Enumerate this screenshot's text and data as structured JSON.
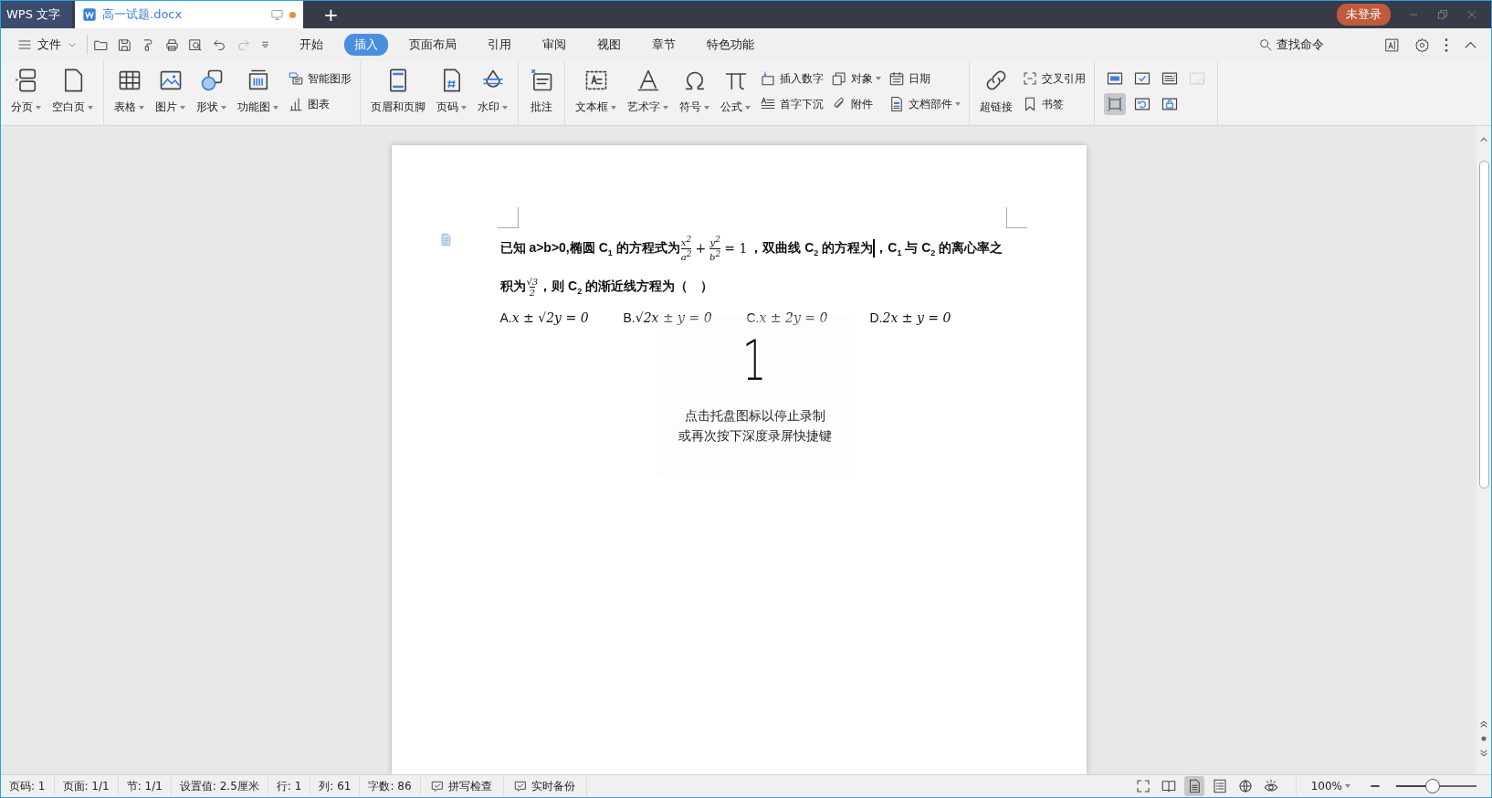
{
  "title_bar": {
    "app_tab": "WPS 文字",
    "document_tab": {
      "title": "高一试题.docx",
      "modified": true
    },
    "new_tab": "+",
    "login_button": "未登录"
  },
  "menu_bar": {
    "file_menu": "文件",
    "quick_access": [
      {
        "disabled": false
      },
      {
        "disabled": false
      },
      {
        "disabled": false
      },
      {
        "disabled": false
      },
      {
        "disabled": false
      },
      {
        "disabled": false
      },
      {
        "disabled": true
      }
    ],
    "tabs": [
      {
        "label": "开始",
        "selected": false
      },
      {
        "label": "插入",
        "selected": true
      },
      {
        "label": "页面布局",
        "selected": false
      },
      {
        "label": "引用",
        "selected": false
      },
      {
        "label": "审阅",
        "selected": false
      },
      {
        "label": "视图",
        "selected": false
      },
      {
        "label": "章节",
        "selected": false
      },
      {
        "label": "特色功能",
        "selected": false
      }
    ],
    "search_command": "查找命令"
  },
  "ribbon": {
    "groups": [
      {
        "items": [
          {
            "kind": "large",
            "label": "分页",
            "dropdown": true
          },
          {
            "kind": "large",
            "label": "空白页",
            "dropdown": true
          }
        ]
      },
      {
        "items": [
          {
            "kind": "large",
            "label": "表格",
            "dropdown": true
          },
          {
            "kind": "large",
            "label": "图片",
            "dropdown": true
          },
          {
            "kind": "large",
            "label": "形状",
            "dropdown": true
          },
          {
            "kind": "large",
            "label": "功能图",
            "dropdown": true
          },
          {
            "kind": "stack",
            "items": [
              {
                "label": "智能图形",
                "dropdown": false
              },
              {
                "label": "图表",
                "dropdown": false
              }
            ]
          }
        ]
      },
      {
        "items": [
          {
            "kind": "large",
            "label": "页眉和页脚",
            "dropdown": false
          },
          {
            "kind": "large",
            "label": "页码",
            "dropdown": true
          },
          {
            "kind": "large",
            "label": "水印",
            "dropdown": true
          }
        ]
      },
      {
        "items": [
          {
            "kind": "large",
            "label": "批注",
            "dropdown": false
          }
        ]
      },
      {
        "items": [
          {
            "kind": "large",
            "label": "文本框",
            "dropdown": true
          },
          {
            "kind": "large",
            "label": "艺术字",
            "dropdown": true
          },
          {
            "kind": "large",
            "label": "符号",
            "dropdown": true
          },
          {
            "kind": "large",
            "label": "公式",
            "dropdown": true
          },
          {
            "kind": "stack",
            "items": [
              {
                "label": "插入数字",
                "dropdown": false
              },
              {
                "label": "首字下沉",
                "dropdown": false
              }
            ]
          },
          {
            "kind": "stack",
            "items": [
              {
                "label": "对象",
                "dropdown": true
              },
              {
                "label": "附件",
                "dropdown": false
              }
            ]
          },
          {
            "kind": "stack",
            "items": [
              {
                "label": "日期",
                "dropdown": false
              },
              {
                "label": "文档部件",
                "dropdown": true
              }
            ]
          }
        ]
      },
      {
        "items": [
          {
            "kind": "large",
            "label": "超链接",
            "dropdown": false
          },
          {
            "kind": "stack",
            "items": [
              {
                "label": "交叉引用",
                "dropdown": false
              },
              {
                "label": "书签",
                "dropdown": false
              }
            ]
          }
        ]
      },
      {
        "items": [
          {
            "kind": "grid",
            "buttons": [
              {
                "selected": false,
                "disabled": false
              },
              {
                "selected": false,
                "disabled": false
              },
              {
                "selected": false,
                "disabled": false
              },
              {
                "selected": false,
                "disabled": true
              },
              {
                "selected": true,
                "disabled": false
              },
              {
                "selected": false,
                "disabled": false
              },
              {
                "selected": false,
                "disabled": false
              }
            ]
          }
        ]
      }
    ]
  },
  "document": {
    "lines": [
      [
        {
          "kind": "text",
          "text": "已知 a>b>0,椭圆 C$_{1}$ 的方程式为"
        },
        {
          "kind": "frac",
          "num": "x$^{2}$",
          "den": "a$^{2}$"
        },
        {
          "kind": "math",
          "text": "+"
        },
        {
          "kind": "frac",
          "num": "y$^{2}$",
          "den": "b$^{2}$"
        },
        {
          "kind": "math",
          "text": "= 1"
        },
        {
          "kind": "text",
          "text": "，双曲线 C$_{2}$ 的方程为"
        },
        {
          "kind": "cursor"
        },
        {
          "kind": "text",
          "text": "，C$_{1}$ 与 C$_{2}$ 的离心率之"
        }
      ],
      [
        {
          "kind": "text",
          "text": "积为"
        },
        {
          "kind": "frac",
          "num": "√3",
          "den": "2"
        },
        {
          "kind": "text",
          "text": "，则 C$_{2}$ 的渐近线方程为（　）"
        }
      ]
    ],
    "options": [
      {
        "letter": "A.",
        "formula": "x ± √2y = 0"
      },
      {
        "letter": "B.",
        "formula": "√2x ± y = 0"
      },
      {
        "letter": "C.",
        "formula": "x ± 2y = 0"
      },
      {
        "letter": "D.",
        "formula": "2x ± y = 0"
      }
    ]
  },
  "recording_overlay": {
    "countdown": "1",
    "lines": [
      "点击托盘图标以停止录制",
      "或再次按下深度录屏快捷键"
    ]
  },
  "status_bar": {
    "items": [
      "页码: 1",
      "页面: 1/1",
      "节: 1/1",
      "设置值: 2.5厘米",
      "行: 1",
      "列: 61",
      "字数: 86"
    ],
    "buttons": [
      "拼写检查",
      "实时备份"
    ],
    "view_modes": [
      {
        "selected": false
      },
      {
        "selected": false
      },
      {
        "selected": true
      },
      {
        "selected": false
      },
      {
        "selected": false
      },
      {
        "selected": false
      }
    ],
    "zoom": "100%",
    "zoom_slider": {
      "level": 0.45
    }
  }
}
